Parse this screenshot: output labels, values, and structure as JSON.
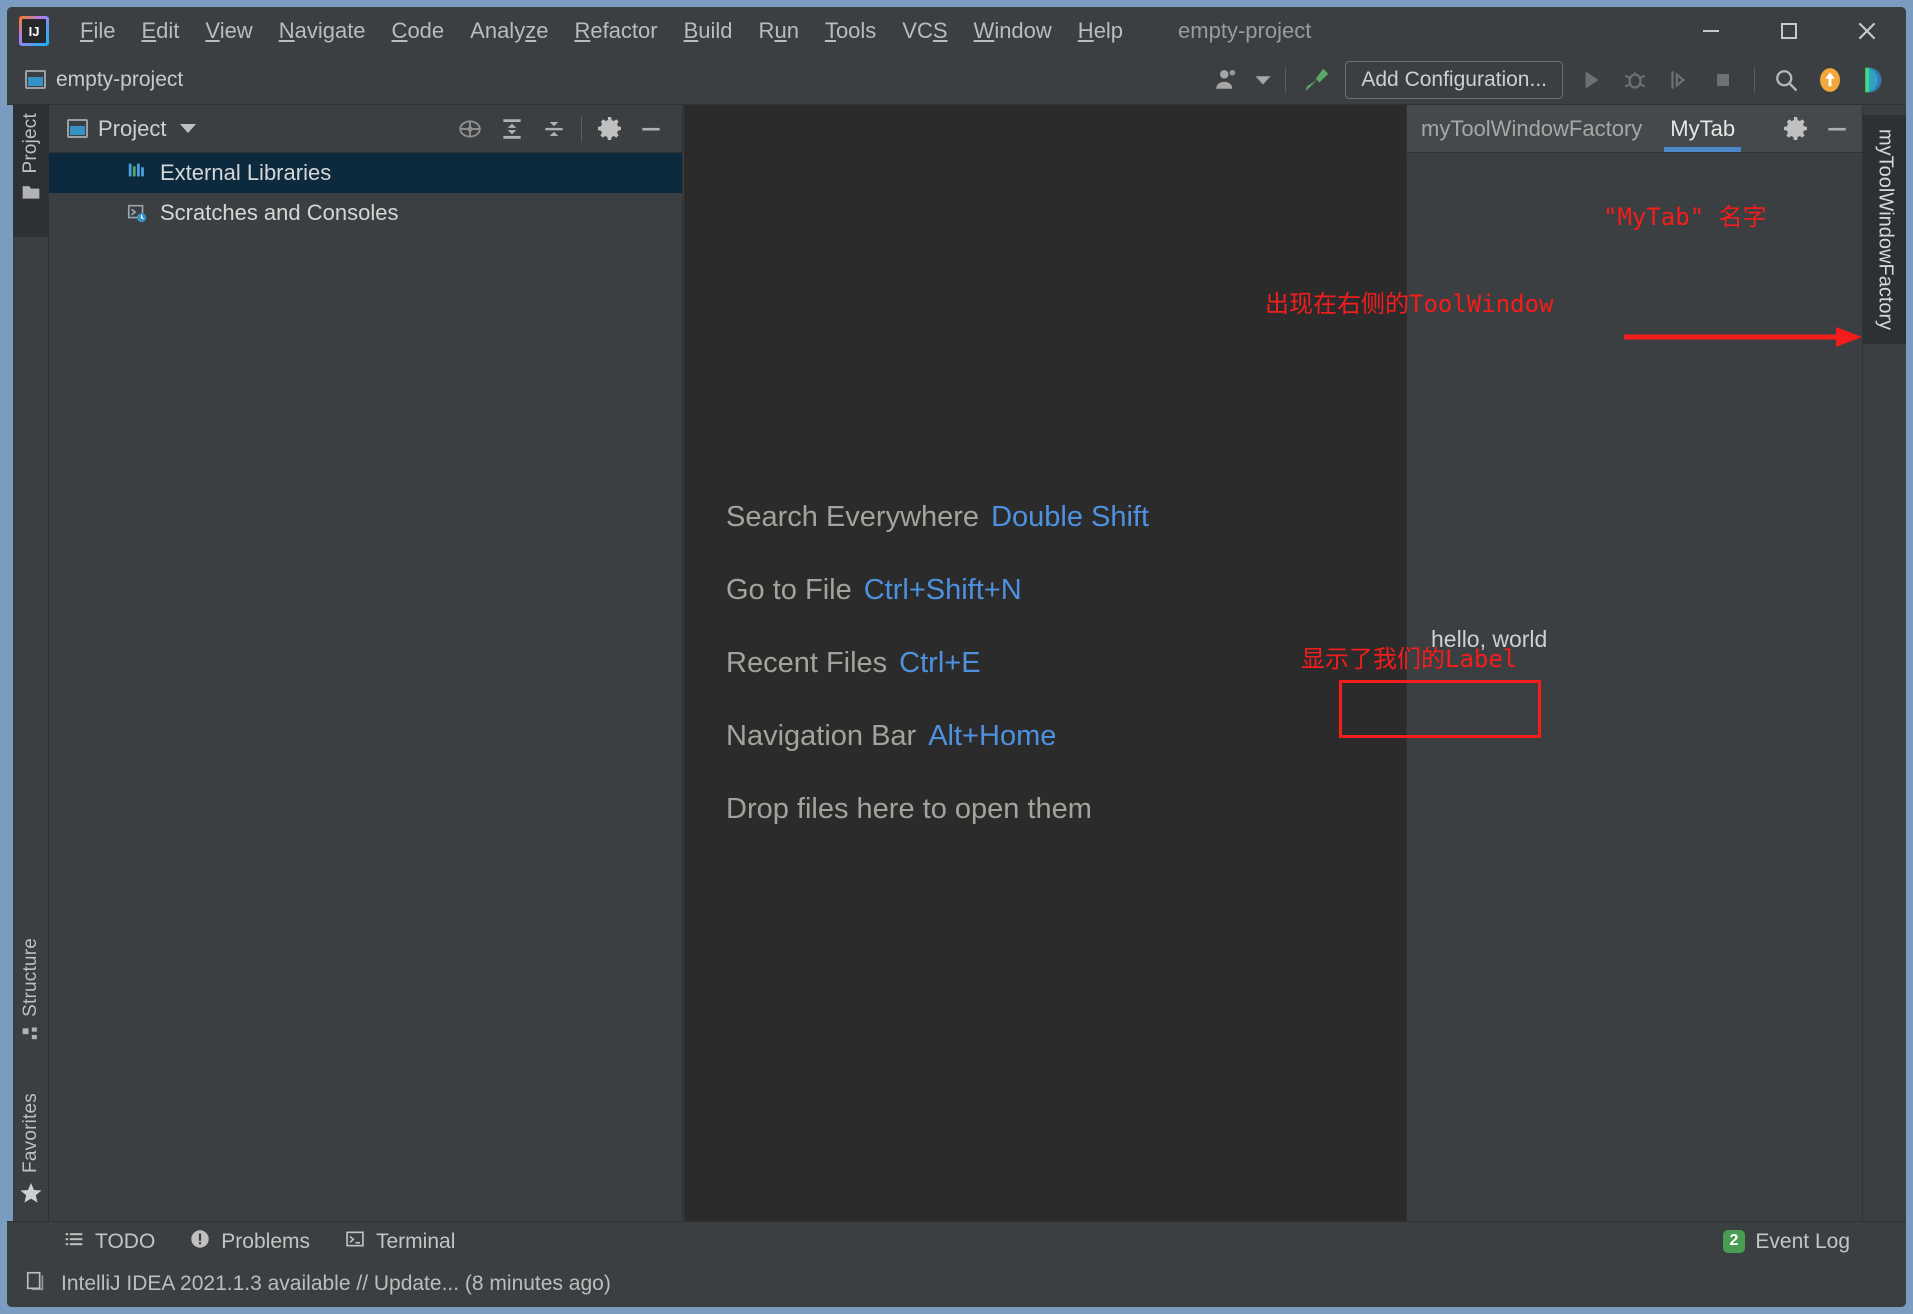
{
  "window": {
    "title": "empty-project",
    "controls": [
      {
        "name": "minimize-button",
        "glyph": "minimize"
      },
      {
        "name": "maximize-button",
        "glyph": "maximize"
      },
      {
        "name": "close-button",
        "glyph": "close"
      }
    ]
  },
  "menubar": {
    "logo_text": "IJ",
    "items": [
      {
        "label": "File",
        "mnemonic": "F"
      },
      {
        "label": "Edit",
        "mnemonic": "E"
      },
      {
        "label": "View",
        "mnemonic": "V"
      },
      {
        "label": "Navigate",
        "mnemonic": "N"
      },
      {
        "label": "Code",
        "mnemonic": "C"
      },
      {
        "label": "Analyze",
        "mnemonic": "z"
      },
      {
        "label": "Refactor",
        "mnemonic": "R"
      },
      {
        "label": "Build",
        "mnemonic": "B"
      },
      {
        "label": "Run",
        "mnemonic": "u"
      },
      {
        "label": "Tools",
        "mnemonic": "T"
      },
      {
        "label": "VCS",
        "mnemonic": "S"
      },
      {
        "label": "Window",
        "mnemonic": "W"
      },
      {
        "label": "Help",
        "mnemonic": "H"
      }
    ]
  },
  "toolbar": {
    "project_tab_label": "empty-project",
    "add_configuration_label": "Add Configuration...",
    "icons": [
      {
        "name": "people-icon",
        "label": "people"
      },
      {
        "name": "build-hammer-icon",
        "label": "build"
      },
      {
        "name": "run-icon",
        "label": "run"
      },
      {
        "name": "debug-icon",
        "label": "debug"
      },
      {
        "name": "run-with-coverage-icon",
        "label": "coverage"
      },
      {
        "name": "stop-icon",
        "label": "stop"
      },
      {
        "name": "search-icon",
        "label": "search"
      },
      {
        "name": "update-project-icon",
        "label": "update"
      },
      {
        "name": "ide-feature-icon",
        "label": "feature"
      }
    ]
  },
  "left_bar": {
    "tabs": [
      {
        "label": "Project",
        "icon": "folder-icon",
        "selected": true
      },
      {
        "label": "Structure",
        "icon": "structure-icon",
        "selected": false
      },
      {
        "label": "Favorites",
        "icon": "star-icon",
        "selected": false
      }
    ]
  },
  "project_panel": {
    "header_title": "Project",
    "header_icons": [
      {
        "name": "select-opened-file-icon"
      },
      {
        "name": "expand-all-icon"
      },
      {
        "name": "collapse-all-icon"
      },
      {
        "name": "gear-icon"
      },
      {
        "name": "hide-icon"
      }
    ],
    "tree": [
      {
        "label": "External Libraries",
        "icon": "libraries-icon",
        "selected": true
      },
      {
        "label": "Scratches and Consoles",
        "icon": "scratches-icon",
        "selected": false
      }
    ]
  },
  "editor": {
    "hints": [
      {
        "action": "Search Everywhere",
        "shortcut": "Double Shift"
      },
      {
        "action": "Go to File",
        "shortcut": "Ctrl+Shift+N"
      },
      {
        "action": "Recent Files",
        "shortcut": "Ctrl+E"
      },
      {
        "action": "Navigation Bar",
        "shortcut": "Alt+Home"
      },
      {
        "action": "Drop files here to open them",
        "shortcut": ""
      }
    ]
  },
  "tool_window": {
    "tabs": [
      {
        "label": "myToolWindowFactory",
        "active": false
      },
      {
        "label": "MyTab",
        "active": true
      }
    ],
    "icons": [
      {
        "name": "gear-icon"
      },
      {
        "name": "hide-icon"
      }
    ],
    "content_label": "hello, world",
    "right_vertical_tab": "myToolWindowFactory"
  },
  "annotations": [
    {
      "name": "annotation-mytab-name",
      "text": "\"MyTab\" 名字"
    },
    {
      "name": "annotation-toolwindow",
      "text": "出现在右侧的ToolWindow"
    },
    {
      "name": "annotation-label",
      "text": "显示了我们的Label"
    }
  ],
  "bottom_bar": {
    "items": [
      {
        "label": "TODO",
        "icon": "todo-list-icon"
      },
      {
        "label": "Problems",
        "icon": "problems-icon"
      },
      {
        "label": "Terminal",
        "icon": "terminal-icon"
      }
    ],
    "event_log": {
      "label": "Event Log",
      "count": "2"
    }
  },
  "status_bar": {
    "message": "IntelliJ IDEA 2021.1.3 available // Update... (8 minutes ago)",
    "icon": "notification-icon"
  },
  "colors": {
    "accent_blue": "#4a88c7",
    "annotation_red": "#f51c1c",
    "badge_green": "#499c54",
    "selection_blue": "#0d293e",
    "editor_bg": "#2b2b2b",
    "panel_bg": "#3c3f41"
  }
}
